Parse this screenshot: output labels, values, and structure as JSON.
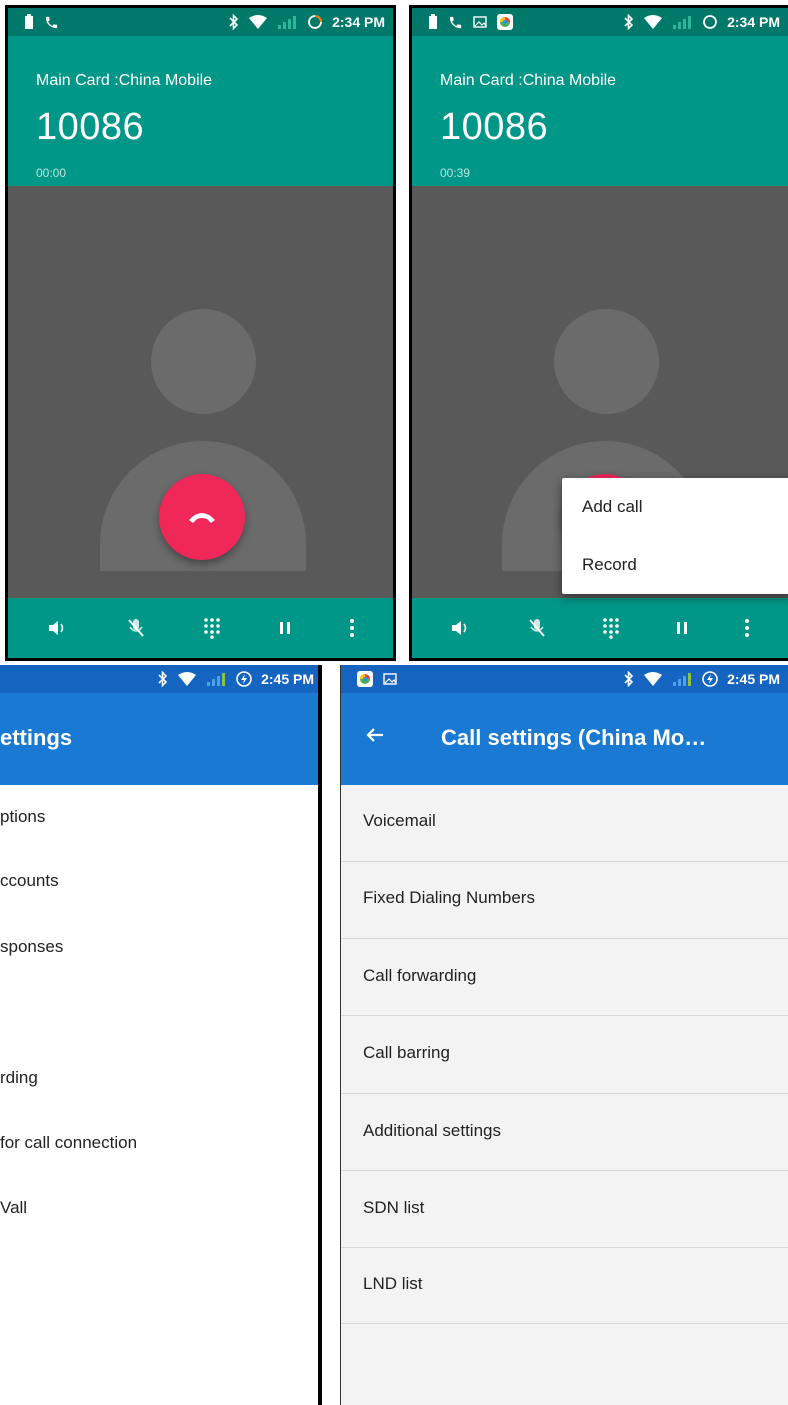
{
  "call_screen_1": {
    "status": {
      "time": "2:34 PM"
    },
    "carrier": "Main Card :China Mobile",
    "number": "10086",
    "timer": "00:00"
  },
  "call_screen_2": {
    "status": {
      "time": "2:34 PM"
    },
    "carrier": "Main Card :China Mobile",
    "number": "10086",
    "timer": "00:39",
    "menu": [
      "Add call",
      "Record"
    ]
  },
  "settings_left": {
    "status": {
      "time": "2:45 PM"
    },
    "title": "ettings",
    "items": [
      "ptions",
      "ccounts",
      "sponses",
      "rding",
      " for call connection",
      "Vall"
    ]
  },
  "settings_right": {
    "status": {
      "time": "2:45 PM"
    },
    "title": "Call settings (China Mo…",
    "items": [
      "Voicemail",
      "Fixed Dialing Numbers",
      "Call forwarding",
      "Call barring",
      "Additional settings",
      "SDN list",
      "LND list"
    ]
  },
  "colors": {
    "call_teal": "#009688",
    "call_body": "#595959",
    "end_call_red": "#f0285a",
    "settings_blue": "#1979d3"
  }
}
